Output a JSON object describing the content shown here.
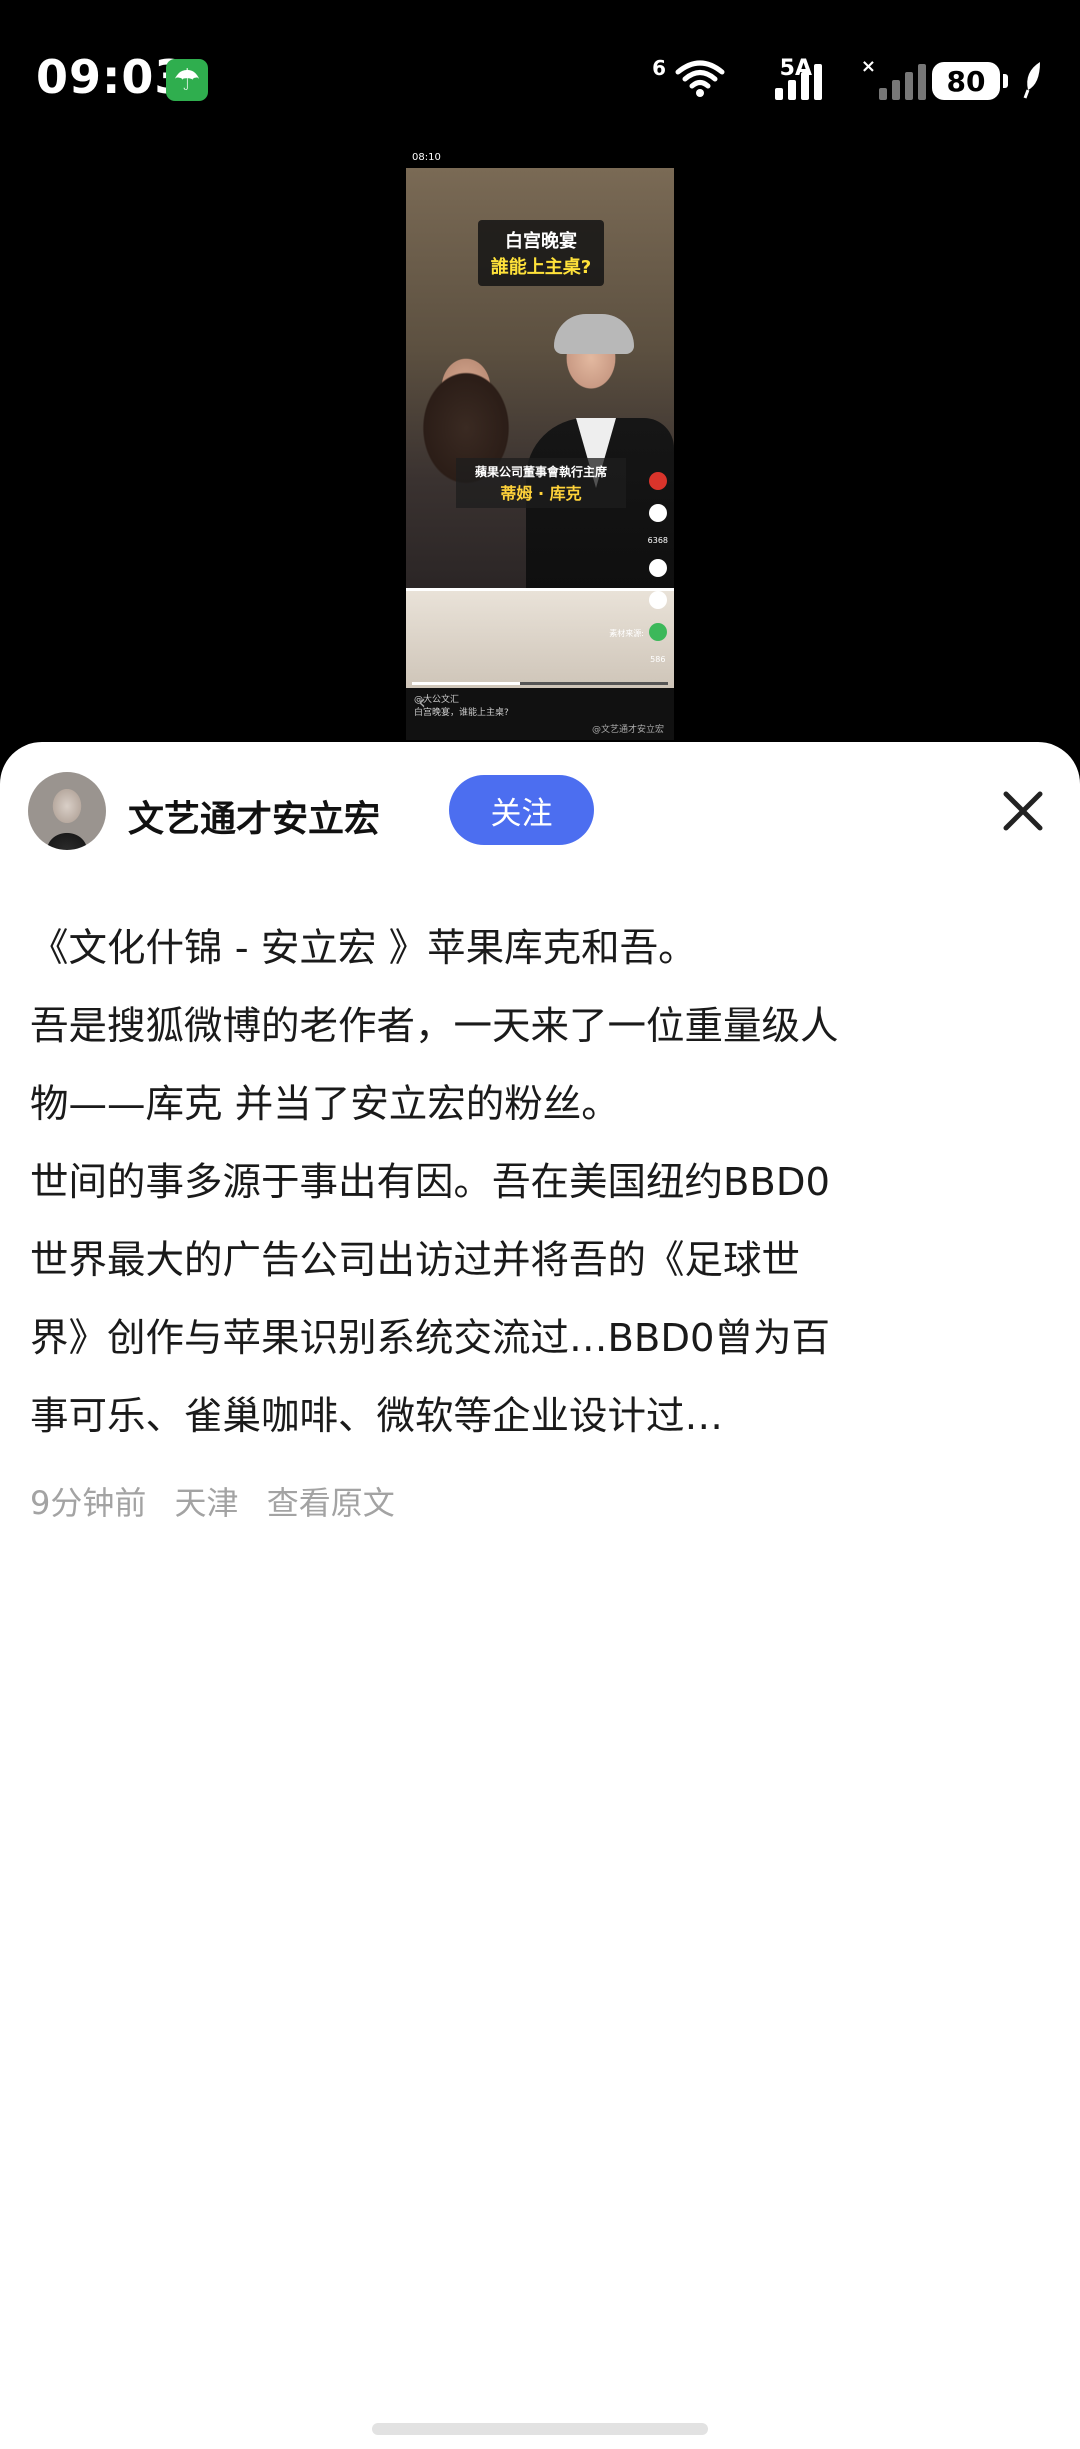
{
  "status_bar": {
    "time": "09:03",
    "network_a": "6",
    "network_b": "5A",
    "battery": "80",
    "icons": [
      "umbrella-icon",
      "wifi-icon",
      "signal-icon",
      "battery-icon",
      "leaf-icon"
    ]
  },
  "video": {
    "time": "08:10",
    "title_line1": "白宫晚宴",
    "title_line2": "誰能上主桌?",
    "caption_line1": "蘋果公司董事會執行主席",
    "caption_line2": "蒂姆 · 库克",
    "likes": "6368",
    "shares": "586",
    "source_label": "素材来源:",
    "bottom_author": "@大公文汇",
    "bottom_title": "白宫晚宴，谁能上主桌?",
    "watermark": "@文艺通才安立宏",
    "progress": 0.42
  },
  "post": {
    "author": "文艺通才安立宏",
    "follow_label": "关注",
    "lines": [
      "《文化什锦 - 安立宏 》苹果库克和吾。",
      "吾是搜狐微博的老作者，一天来了一位重量级人",
      "物——库克 并当了安立宏的粉丝。",
      "世间的事多源于事出有因。吾在美国纽约BBD0",
      "世界最大的广告公司出访过并将吾的《足球世",
      "界》创作与苹果识别系统交流过…BBD0曾为百",
      "事可乐、雀巢咖啡、微软等企业设计过…"
    ],
    "time_ago": "9分钟前",
    "location": "天津",
    "view_original": "查看原文"
  },
  "colors": {
    "accent": "#4c6ef0",
    "meta": "#a3a3a3",
    "umbrella_bg": "#2fae4e"
  }
}
